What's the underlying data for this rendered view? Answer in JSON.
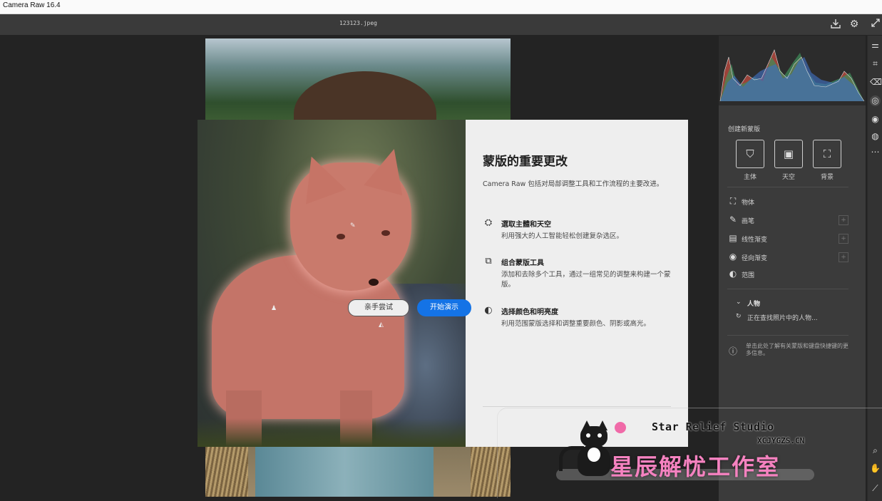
{
  "window": {
    "title": "Camera Raw 16.4"
  },
  "toolbar": {
    "filename": "123123.jpeg",
    "save_icon": "download-icon",
    "settings_icon": "gear-icon",
    "fullscreen_icon": "expand-icon"
  },
  "dialog": {
    "title": "蒙版的重要更改",
    "intro": "Camera Raw 包括对局部调整工具和工作流程的主要改进。",
    "features": [
      {
        "icon": "person-select-icon",
        "title": "選取主體和天空",
        "desc": "利用强大的人工智能轻松创建复杂选区。"
      },
      {
        "icon": "mask-combine-icon",
        "title": "组合蒙版工具",
        "desc": "添加和去除多个工具，通过一组常见的调整来构建一个蒙版。"
      },
      {
        "icon": "range-select-icon",
        "title": "选择颜色和明亮度",
        "desc": "利用范围蒙版选择和调整重要颜色、阴影或高光。"
      }
    ],
    "btn_try": "亲手尝试",
    "btn_start": "开始演示"
  },
  "panel": {
    "create_mask": "创建新蒙版",
    "quick_masks": [
      {
        "label": "主体",
        "icon": "subject-icon"
      },
      {
        "label": "天空",
        "icon": "sky-icon"
      },
      {
        "label": "背景",
        "icon": "background-icon"
      }
    ],
    "tools": [
      {
        "label": "物体",
        "icon": "object-icon",
        "plus": ""
      },
      {
        "label": "画笔",
        "icon": "brush-icon",
        "plus": "+"
      },
      {
        "label": "线性渐变",
        "icon": "linear-gradient-icon",
        "plus": "+"
      },
      {
        "label": "径向渐变",
        "icon": "radial-gradient-icon",
        "plus": "+"
      },
      {
        "label": "范围",
        "icon": "range-icon",
        "plus": ""
      }
    ],
    "people_heading": "人物",
    "people_status": "正在查找照片中的人物...",
    "help_text": "单击此处了解有关蒙版和键盘快捷键的更多信息。"
  },
  "watermark": {
    "en": "Star Relief Studio",
    "url": "XCJYGZS.CN",
    "cn": "星辰解忧工作室",
    "accent": "#f582c0"
  }
}
